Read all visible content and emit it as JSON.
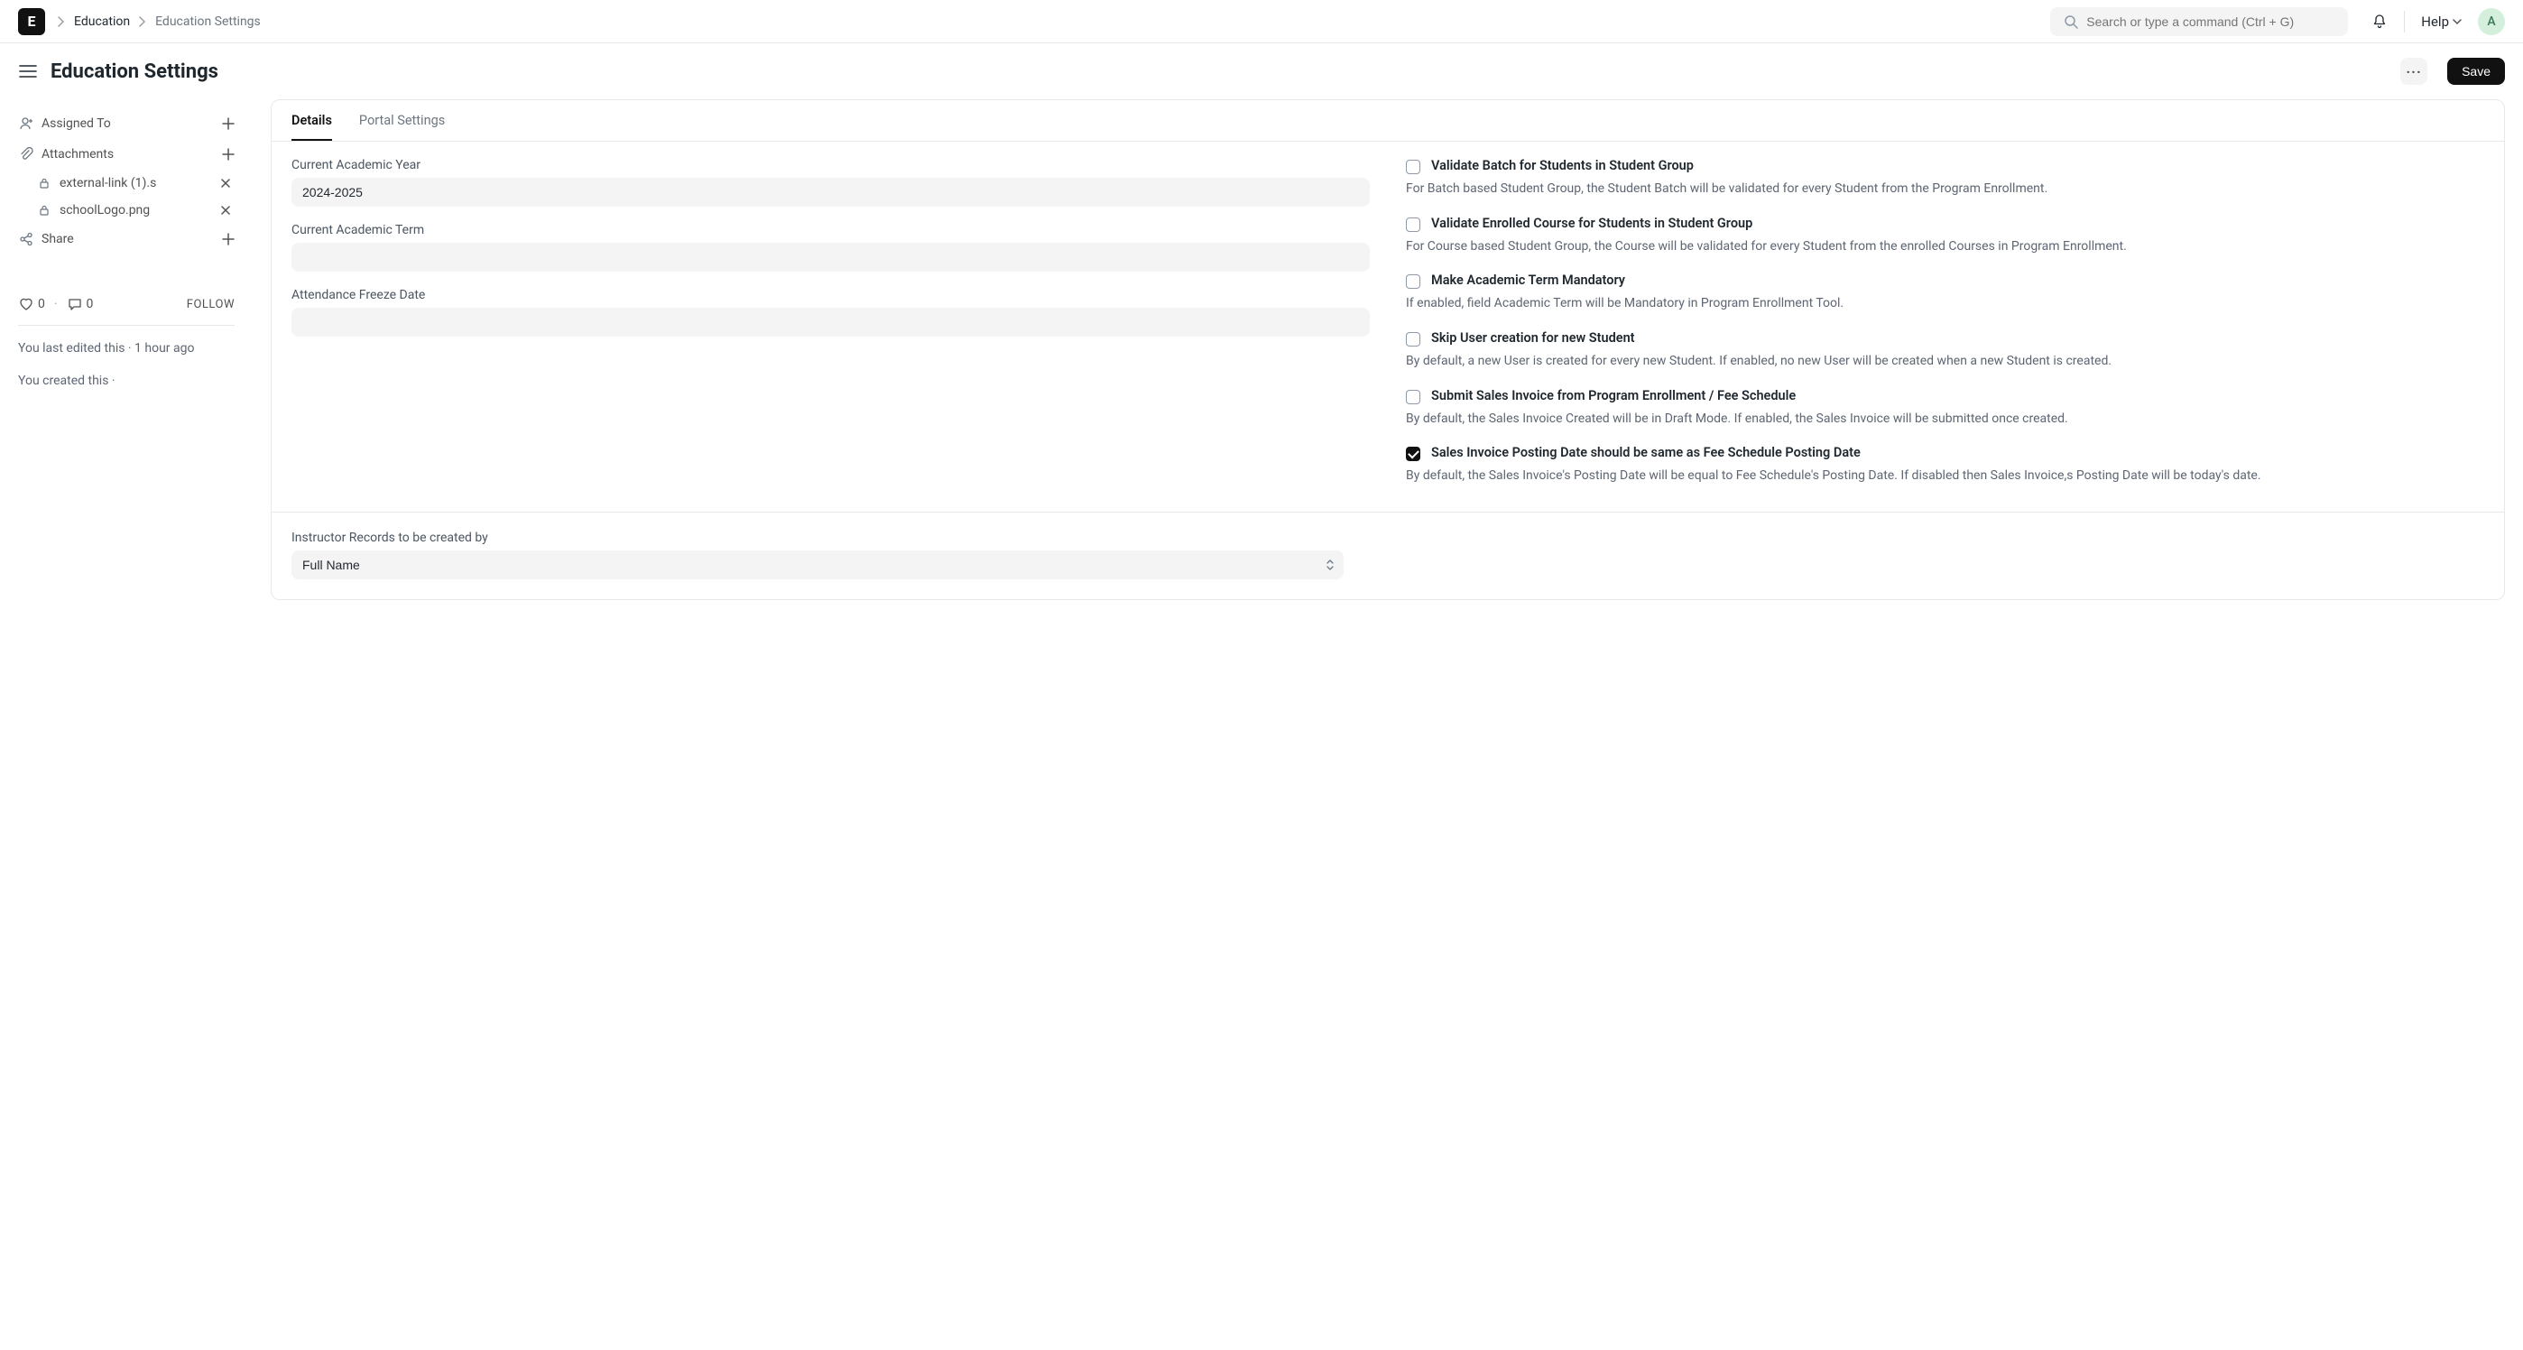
{
  "logo_letter": "E",
  "breadcrumb": {
    "root": "Education",
    "current": "Education Settings"
  },
  "search": {
    "placeholder": "Search or type a command (Ctrl + G)"
  },
  "help_label": "Help",
  "avatar_letter": "A",
  "page_title": "Education Settings",
  "save_label": "Save",
  "sidebar": {
    "assigned_to": "Assigned To",
    "attachments": "Attachments",
    "attachment_items": [
      {
        "name": "external-link (1).s"
      },
      {
        "name": "schoolLogo.png"
      }
    ],
    "share": "Share",
    "likes": "0",
    "comments": "0",
    "follow": "FOLLOW",
    "meta_edited": "You last edited this · 1 hour ago",
    "meta_created": "You created this ·"
  },
  "tabs": [
    {
      "label": "Details",
      "active": true
    },
    {
      "label": "Portal Settings",
      "active": false
    }
  ],
  "fields": {
    "academic_year_label": "Current Academic Year",
    "academic_year_value": "2024-2025",
    "academic_term_label": "Current Academic Term",
    "academic_term_value": "",
    "freeze_date_label": "Attendance Freeze Date",
    "freeze_date_value": "",
    "instructor_records_label": "Instructor Records to be created by",
    "instructor_records_value": "Full Name"
  },
  "checks": [
    {
      "label": "Validate Batch for Students in Student Group",
      "desc": "For Batch based Student Group, the Student Batch will be validated for every Student from the Program Enrollment.",
      "checked": false
    },
    {
      "label": "Validate Enrolled Course for Students in Student Group",
      "desc": "For Course based Student Group, the Course will be validated for every Student from the enrolled Courses in Program Enrollment.",
      "checked": false
    },
    {
      "label": "Make Academic Term Mandatory",
      "desc": "If enabled, field Academic Term will be Mandatory in Program Enrollment Tool.",
      "checked": false
    },
    {
      "label": "Skip User creation for new Student",
      "desc": "By default, a new User is created for every new Student. If enabled, no new User will be created when a new Student is created.",
      "checked": false
    },
    {
      "label": "Submit Sales Invoice from Program Enrollment / Fee Schedule",
      "desc": "By default, the Sales Invoice Created will be in Draft Mode. If enabled, the Sales Invoice will be submitted once created.",
      "checked": false
    },
    {
      "label": "Sales Invoice Posting Date should be same as Fee Schedule Posting Date",
      "desc": "By default, the Sales Invoice's Posting Date will be equal to Fee Schedule's Posting Date. If disabled then Sales Invoice,s Posting Date will be today's date.",
      "checked": true
    }
  ]
}
